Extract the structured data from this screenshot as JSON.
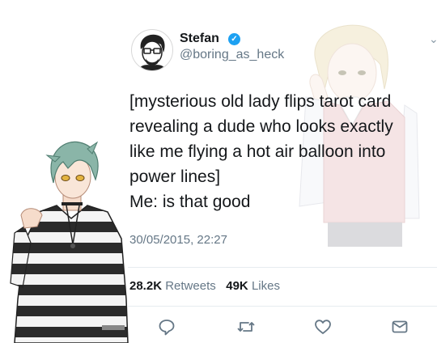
{
  "author": {
    "name": "Stefan",
    "handle": "@boring_as_heck",
    "verified": true,
    "avatar": "cartoon-man-with-glasses-avatar"
  },
  "tweet": {
    "lines": [
      "[mysterious old lady flips tarot card",
      "revealing a dude who looks exactly",
      "like me flying a hot air balloon into",
      "power lines]",
      "Me: is that good"
    ],
    "timestamp": "30/05/2015, 22:27"
  },
  "stats": {
    "retweets_count": "28.2K",
    "retweets_label": "Retweets",
    "likes_count": "49K",
    "likes_label": "Likes"
  },
  "actions": [
    "reply-icon",
    "retweet-icon",
    "like-icon",
    "message-icon"
  ],
  "colors": {
    "verified": "#1da1f2",
    "secondary_text": "#657786",
    "icon": "#657786"
  },
  "overlays": [
    "anime-character-striped-sweater",
    "anime-character-pink-vest-faded"
  ]
}
